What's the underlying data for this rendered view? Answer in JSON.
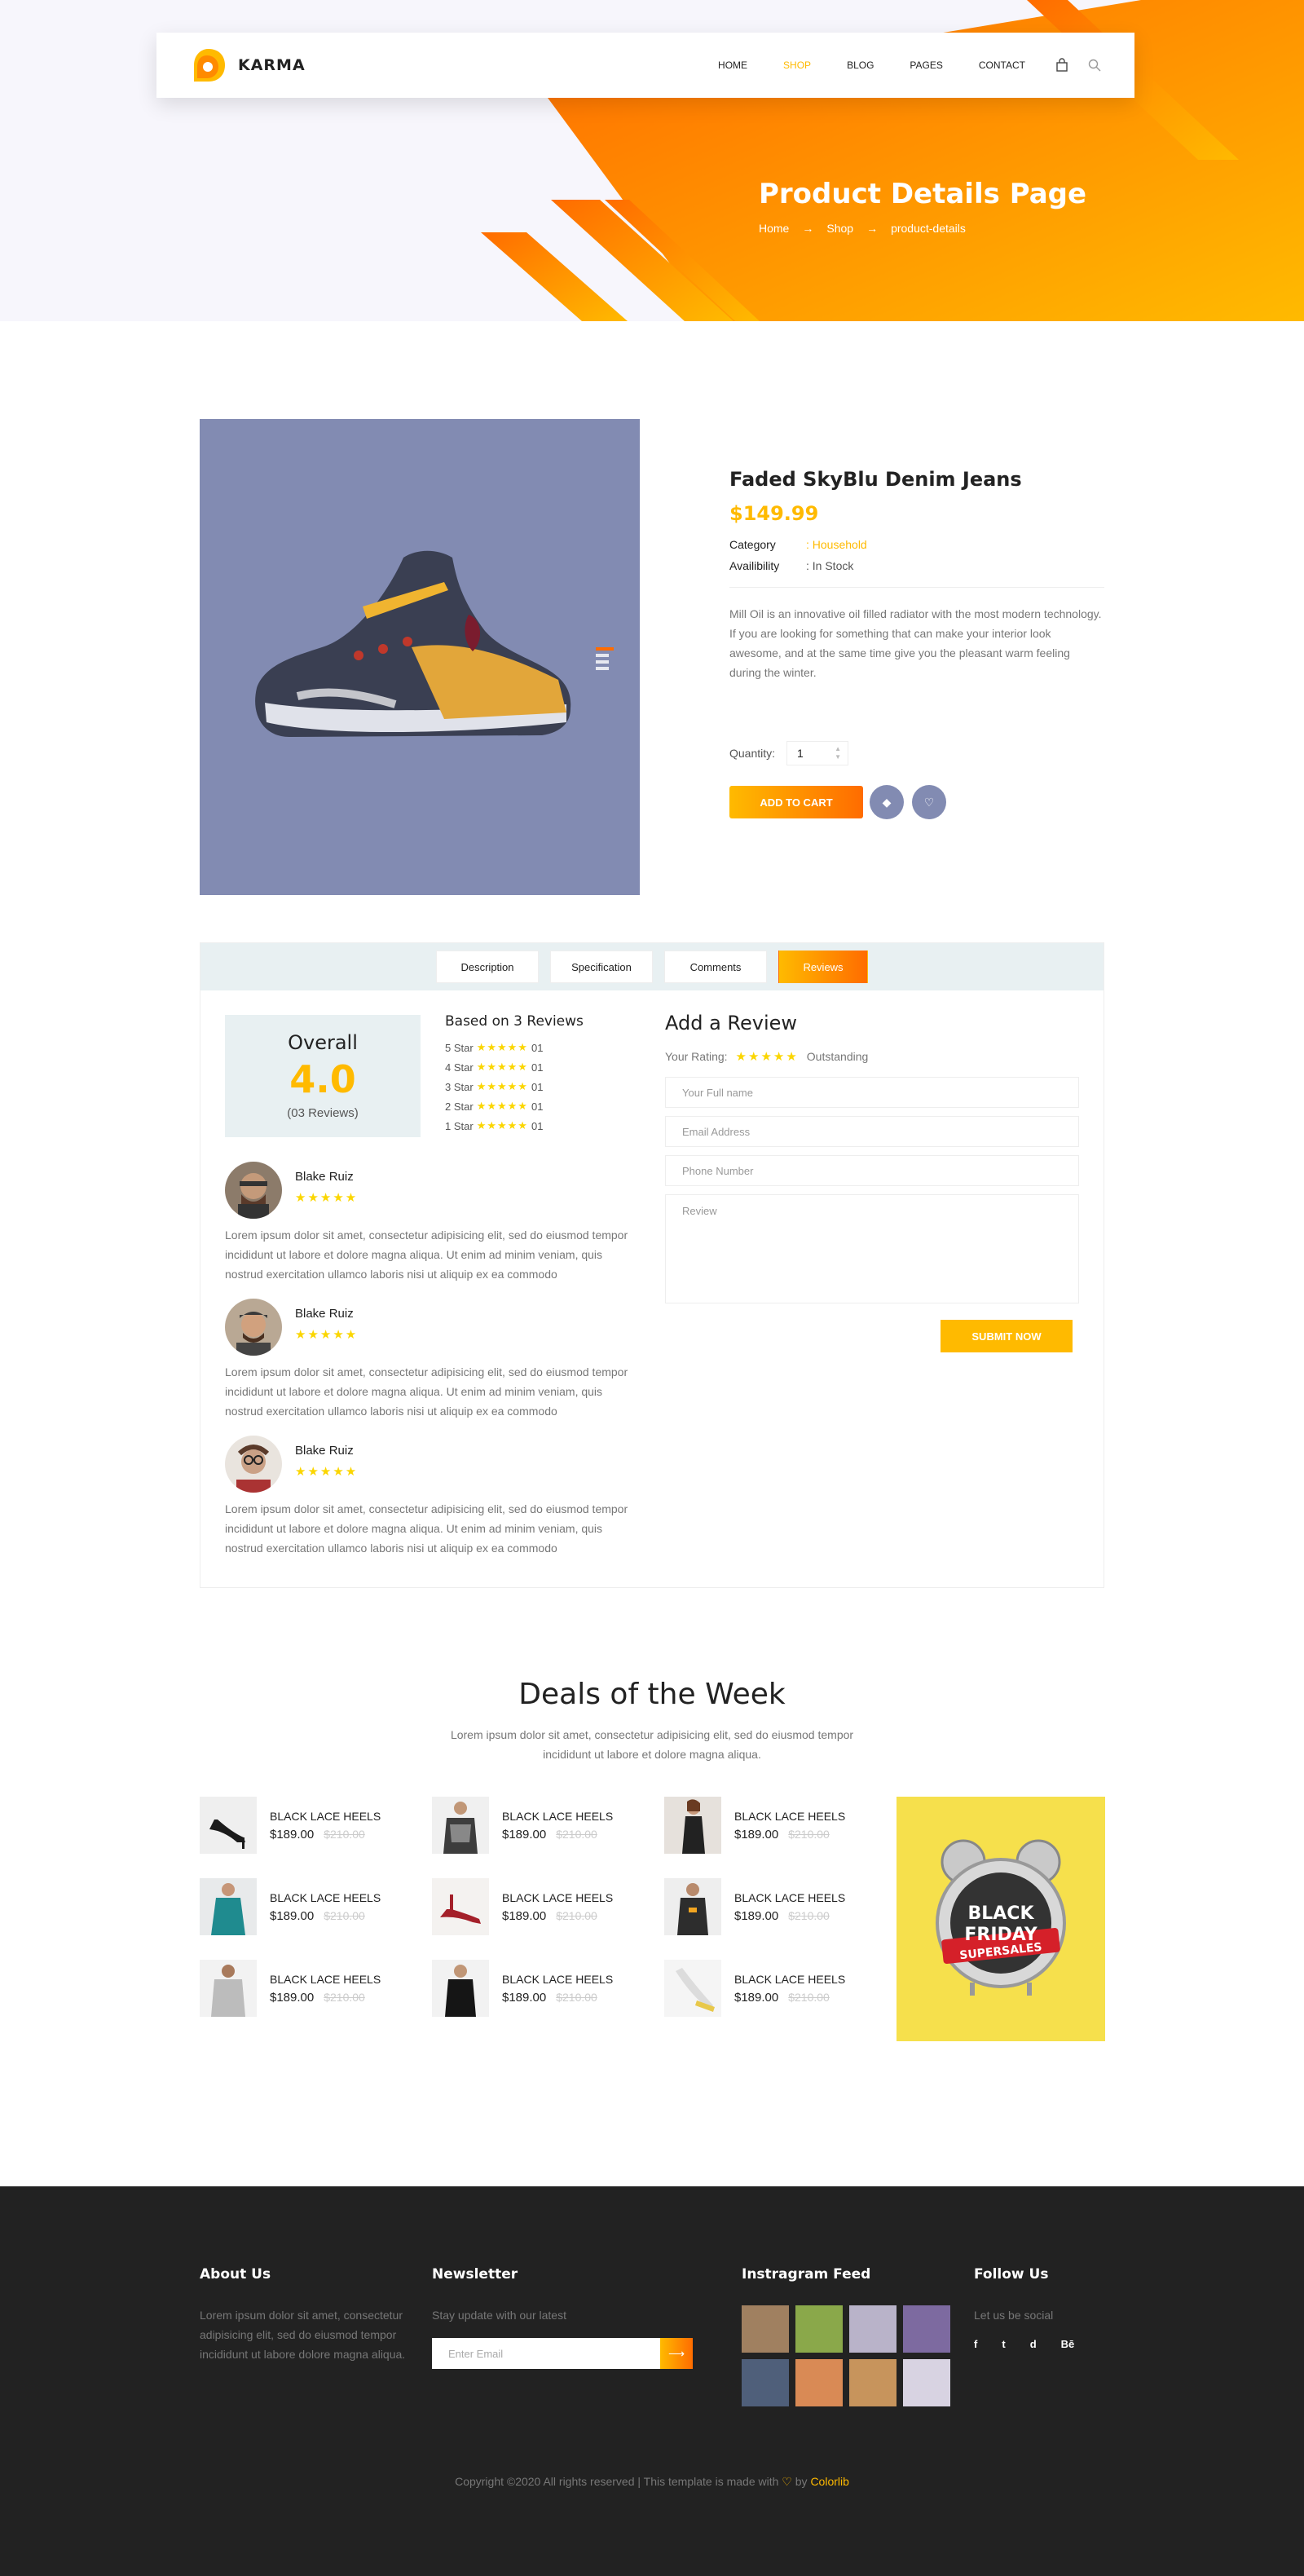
{
  "brand": {
    "name": "KARMA"
  },
  "nav": {
    "items": [
      "HOME",
      "SHOP",
      "BLOG",
      "PAGES",
      "CONTACT"
    ],
    "active": "SHOP",
    "icons": [
      "cart-icon",
      "search-icon"
    ]
  },
  "banner": {
    "title": "Product Details Page",
    "breadcrumb": [
      "Home",
      "Shop",
      "product-details"
    ]
  },
  "product": {
    "name": "Faded SkyBlu Denim Jeans",
    "price": "$149.99",
    "category_label": "Category",
    "category_value": ": Household",
    "availability_label": "Availibility",
    "availability_value": ": In Stock",
    "description": "Mill Oil is an innovative oil filled radiator with the most modern technology. If you are looking for something that can make your interior look awesome, and at the same time give you the pleasant warm feeling during the winter.",
    "quantity_label": "Quantity:",
    "quantity_value": "1",
    "add_to_cart": "ADD TO CART",
    "image_bg": "#828bb2"
  },
  "tabs": [
    "Description",
    "Specification",
    "Comments",
    "Reviews"
  ],
  "active_tab": "Reviews",
  "reviews": {
    "overall_label": "Overall",
    "overall_score": "4.0",
    "overall_count": "(03 Reviews)",
    "based_on": "Based on 3 Reviews",
    "breakdown": [
      {
        "label": "5 Star",
        "count": "01"
      },
      {
        "label": "4 Star",
        "count": "01"
      },
      {
        "label": "3 Star",
        "count": "01"
      },
      {
        "label": "2 Star",
        "count": "01"
      },
      {
        "label": "1 Star",
        "count": "01"
      }
    ],
    "items": [
      {
        "name": "Blake Ruiz",
        "text": "Lorem ipsum dolor sit amet, consectetur adipisicing elit, sed do eiusmod tempor incididunt ut labore et dolore magna aliqua. Ut enim ad minim veniam, quis nostrud exercitation ullamco laboris nisi ut aliquip ex ea commodo"
      },
      {
        "name": "Blake Ruiz",
        "text": "Lorem ipsum dolor sit amet, consectetur adipisicing elit, sed do eiusmod tempor incididunt ut labore et dolore magna aliqua. Ut enim ad minim veniam, quis nostrud exercitation ullamco laboris nisi ut aliquip ex ea commodo"
      },
      {
        "name": "Blake Ruiz",
        "text": "Lorem ipsum dolor sit amet, consectetur adipisicing elit, sed do eiusmod tempor incididunt ut labore et dolore magna aliqua. Ut enim ad minim veniam, quis nostrud exercitation ullamco laboris nisi ut aliquip ex ea commodo"
      }
    ],
    "stars": "★★★★★"
  },
  "add_review": {
    "title": "Add a Review",
    "rating_label": "Your Rating:",
    "rating_stars": "★★★★★",
    "rating_text": "Outstanding",
    "fields": [
      "Your Full name",
      "Email Address",
      "Phone Number",
      "Review"
    ],
    "submit": "SUBMIT NOW"
  },
  "deals": {
    "title": "Deals of the Week",
    "subtitle": "Lorem ipsum dolor sit amet, consectetur adipisicing elit, sed do eiusmod tempor incididunt ut labore et dolore magna aliqua.",
    "items": [
      {
        "name": "BLACK LACE HEELS",
        "price": "$189.00",
        "old": "$210.00"
      },
      {
        "name": "BLACK LACE HEELS",
        "price": "$189.00",
        "old": "$210.00"
      },
      {
        "name": "BLACK LACE HEELS",
        "price": "$189.00",
        "old": "$210.00"
      },
      {
        "name": "BLACK LACE HEELS",
        "price": "$189.00",
        "old": "$210.00"
      },
      {
        "name": "BLACK LACE HEELS",
        "price": "$189.00",
        "old": "$210.00"
      },
      {
        "name": "BLACK LACE HEELS",
        "price": "$189.00",
        "old": "$210.00"
      },
      {
        "name": "BLACK LACE HEELS",
        "price": "$189.00",
        "old": "$210.00"
      },
      {
        "name": "BLACK LACE HEELS",
        "price": "$189.00",
        "old": "$210.00"
      },
      {
        "name": "BLACK LACE HEELS",
        "price": "$189.00",
        "old": "$210.00"
      }
    ],
    "promo": {
      "line1": "BLACK",
      "line2": "FRIDAY",
      "line3": "SUPERSALES"
    }
  },
  "footer": {
    "about_title": "About Us",
    "about_text": "Lorem ipsum dolor sit amet, consectetur adipisicing elit, sed do eiusmod tempor incididunt ut labore dolore magna aliqua.",
    "newsletter_title": "Newsletter",
    "newsletter_text": "Stay update with our latest",
    "newsletter_placeholder": "Enter Email",
    "insta_title": "Instragram Feed",
    "follow_title": "Follow Us",
    "follow_text": "Let us be social",
    "social": [
      "f",
      "t",
      "d",
      "Bē"
    ],
    "copyright": "Copyright ©2020 All rights reserved | This template is made with",
    "by": "by",
    "credit": "Colorlib"
  },
  "colors": {
    "accent": "#ffba00",
    "accent2": "#ff6c00",
    "footer_bg": "#222222",
    "product_bg": "#828bb2"
  }
}
